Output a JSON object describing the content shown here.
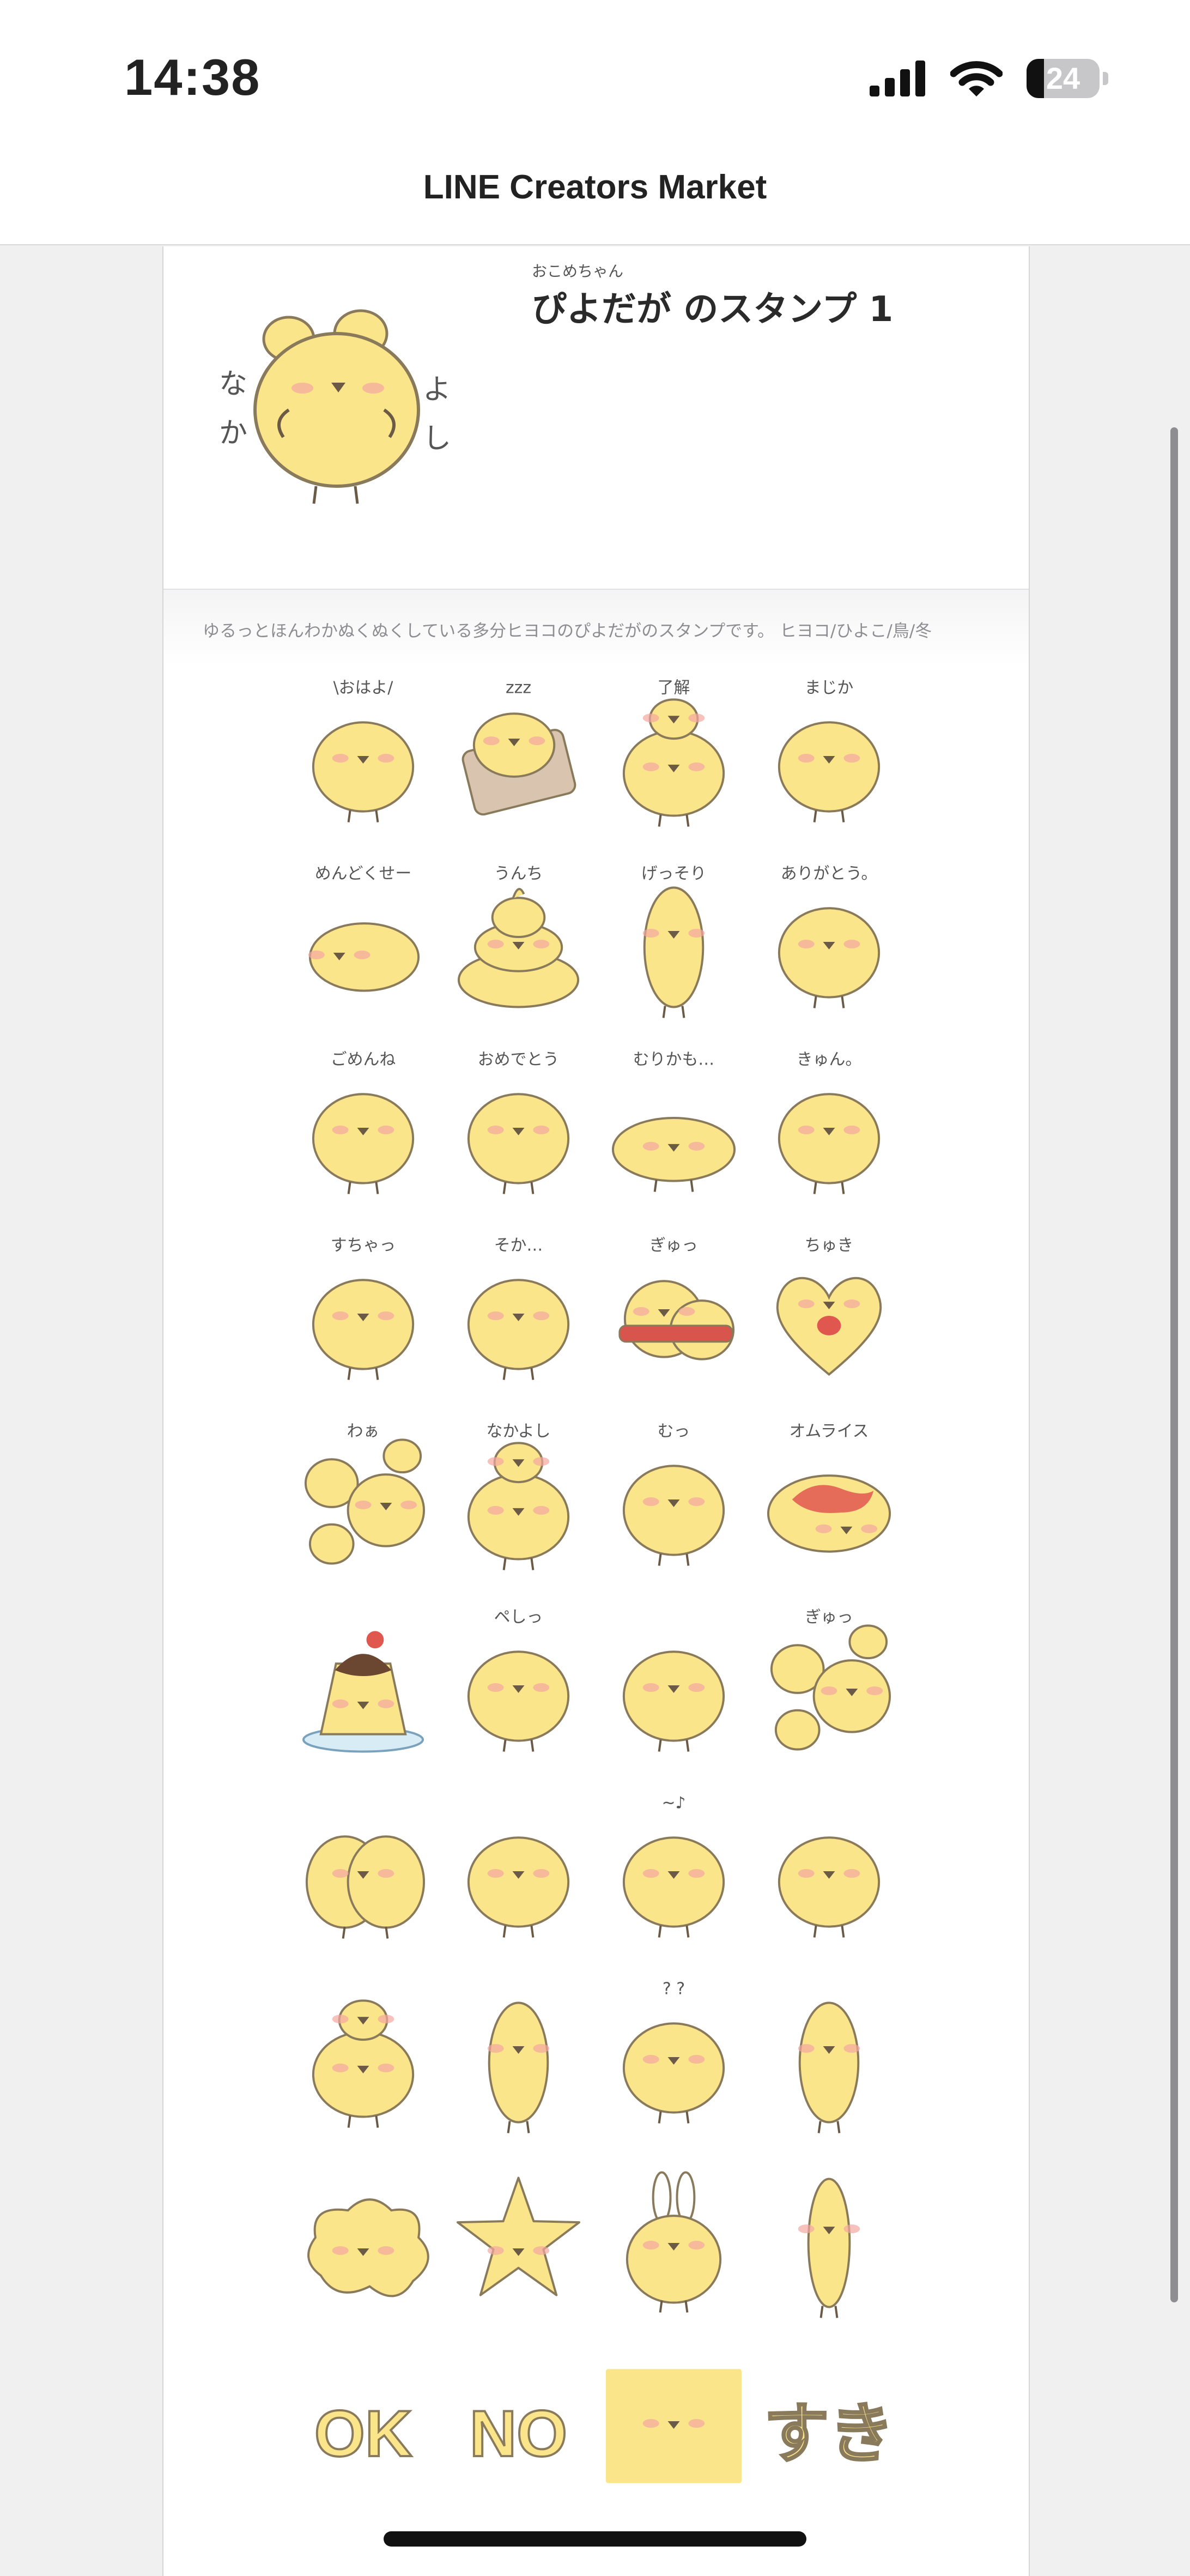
{
  "status_bar": {
    "time": "14:38",
    "battery_level": "24",
    "battery_fraction": 0.24
  },
  "nav": {
    "title": "LINE Creators Market"
  },
  "pack": {
    "title_ruby": "おこめちゃん",
    "title": "ぴよだが のスタンプ 1",
    "description": "ゆるっとほんわかぬくぬくしている多分ヒヨコのぴよだがのスタンプです。 ヒヨコ/ひよこ/鳥/冬",
    "main_image_text": [
      "な",
      "か",
      "よ",
      "し"
    ]
  },
  "colors": {
    "chick": "#fbe58a",
    "outline": "#8a7a5c",
    "blush": "#f3a7a0",
    "beak": "#6b5a45",
    "accent_red": "#e0574f"
  },
  "stickers": [
    {
      "caption": "\\おはよ/",
      "variant": "round"
    },
    {
      "caption": "zzz",
      "variant": "sleep"
    },
    {
      "caption": "了解",
      "variant": "stack"
    },
    {
      "caption": "まじか",
      "variant": "round"
    },
    {
      "caption": "めんどくせー",
      "variant": "lying"
    },
    {
      "caption": "うんち",
      "variant": "poop"
    },
    {
      "caption": "げっそり",
      "variant": "thin"
    },
    {
      "caption": "ありがとう。",
      "variant": "round"
    },
    {
      "caption": "ごめんね",
      "variant": "round"
    },
    {
      "caption": "おめでとう",
      "variant": "round"
    },
    {
      "caption": "むりかも…",
      "variant": "flat"
    },
    {
      "caption": "きゅん。",
      "variant": "round"
    },
    {
      "caption": "すちゃっ",
      "variant": "round"
    },
    {
      "caption": "そか…",
      "variant": "round"
    },
    {
      "caption": "ぎゅっ",
      "variant": "scarf"
    },
    {
      "caption": "ちゅき",
      "variant": "heart"
    },
    {
      "caption": "わぁ",
      "variant": "group"
    },
    {
      "caption": "なかよし",
      "variant": "stack"
    },
    {
      "caption": "むっ",
      "variant": "round"
    },
    {
      "caption": "オムライス",
      "variant": "omurice"
    },
    {
      "caption": "",
      "variant": "pudding"
    },
    {
      "caption": "ペしっ",
      "variant": "round"
    },
    {
      "caption": "",
      "variant": "round"
    },
    {
      "caption": "ぎゅっ",
      "variant": "group"
    },
    {
      "caption": "",
      "variant": "hug"
    },
    {
      "caption": "",
      "variant": "round"
    },
    {
      "caption": "~♪",
      "variant": "round"
    },
    {
      "caption": "",
      "variant": "round"
    },
    {
      "caption": "",
      "variant": "stack"
    },
    {
      "caption": "",
      "variant": "thin"
    },
    {
      "caption": "? ?",
      "variant": "round"
    },
    {
      "caption": "",
      "variant": "thin"
    },
    {
      "caption": "",
      "variant": "splat"
    },
    {
      "caption": "",
      "variant": "star"
    },
    {
      "caption": "",
      "variant": "bunny"
    },
    {
      "caption": "",
      "variant": "tall"
    },
    {
      "caption": "OK",
      "variant": "word"
    },
    {
      "caption": "NO",
      "variant": "word"
    },
    {
      "caption": "",
      "variant": "square"
    },
    {
      "caption": "すき",
      "variant": "word"
    }
  ]
}
